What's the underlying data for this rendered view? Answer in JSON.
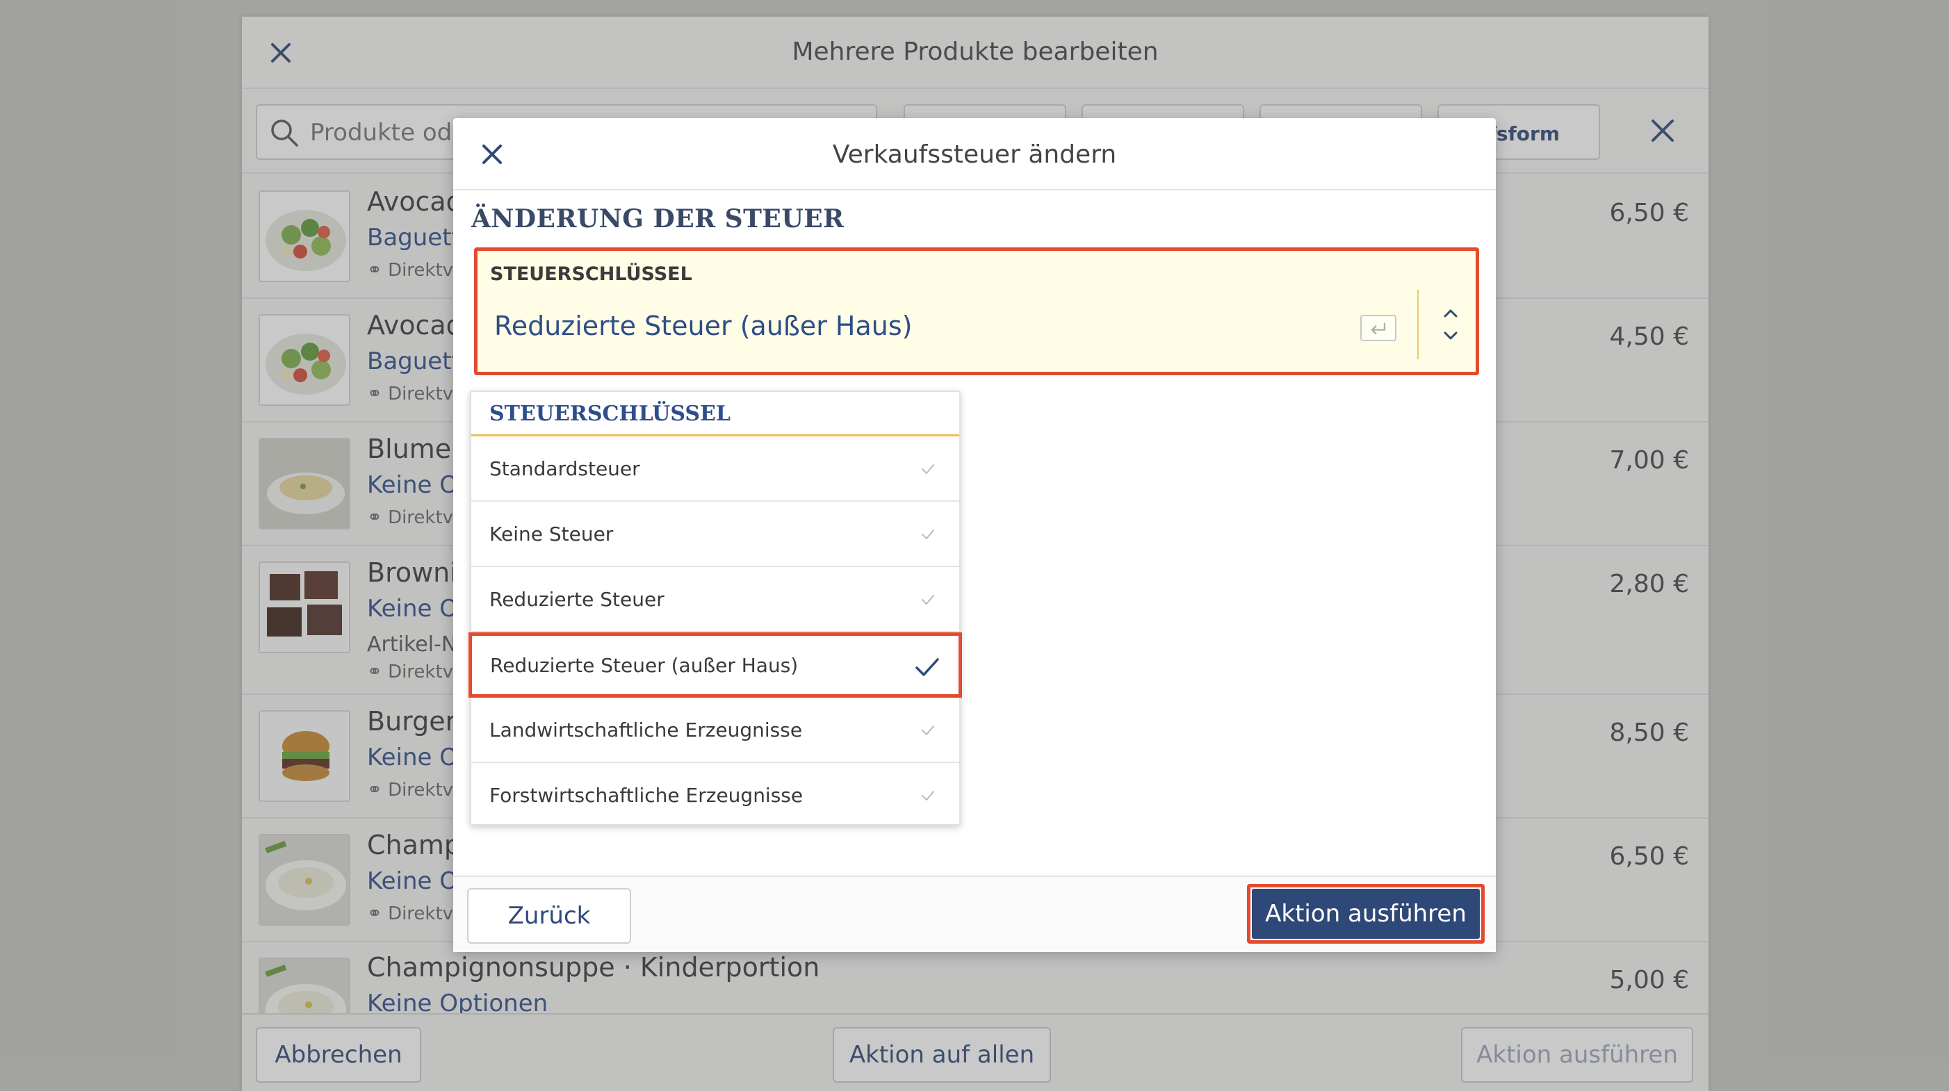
{
  "sheet": {
    "title": "Mehrere Produkte bearbeiten",
    "search_placeholder": "Produkte oder",
    "filter_visible_fragment": "ufsform",
    "products": [
      {
        "name": "Avocad",
        "sub": "Baguette",
        "meta": "Direktve",
        "extra": "",
        "price": "6,50 €"
      },
      {
        "name": "Avocad",
        "sub": "Baguette",
        "meta": "Direktve",
        "extra": "",
        "price": "4,50 €"
      },
      {
        "name": "Blumen",
        "sub": "Keine Op",
        "meta": "Direktve",
        "extra": "",
        "price": "7,00 €"
      },
      {
        "name": "Browni",
        "sub": "Keine Op",
        "meta": "Direktve",
        "extra": "Artikel-N",
        "price": "2,80 €"
      },
      {
        "name": "Burger",
        "sub": "Keine Op",
        "meta": "Direktve",
        "extra": "",
        "price": "8,50 €"
      },
      {
        "name": "Champi",
        "sub": "Keine Op",
        "meta": "Direktve",
        "extra": "",
        "price": "6,50 €"
      },
      {
        "name": "Champignonsuppe · Kinderportion",
        "sub": "Keine Optionen",
        "meta": "",
        "extra": "",
        "price": "5,00 €"
      }
    ],
    "footer": {
      "cancel": "Abbrechen",
      "action_all": "Aktion auf allen",
      "execute": "Aktion ausführen"
    }
  },
  "modal": {
    "title": "Verkaufssteuer ändern",
    "section_title": "ÄNDERUNG DER STEUER",
    "field_label": "STEUERSCHLÜSSEL",
    "field_value": "Reduzierte Steuer (außer Haus)",
    "dropdown_header": "STEUERSCHLÜSSEL",
    "options": [
      {
        "label": "Standardsteuer",
        "selected": false
      },
      {
        "label": "Keine Steuer",
        "selected": false
      },
      {
        "label": "Reduzierte Steuer",
        "selected": false
      },
      {
        "label": "Reduzierte Steuer (außer Haus)",
        "selected": true
      },
      {
        "label": "Landwirtschaftliche Erzeugnisse",
        "selected": false
      },
      {
        "label": "Forstwirtschaftliche Erzeugnisse",
        "selected": false
      }
    ],
    "back_button": "Zurück",
    "execute_button": "Aktion ausführen"
  },
  "colors": {
    "accent": "#2e4878",
    "highlight_border": "#e34a2e",
    "field_bg": "#fffde6"
  },
  "icons": {
    "close": "close-icon",
    "search": "search-icon",
    "enter": "enter-key-icon",
    "updown": "chevron-updown-icon",
    "check": "check-icon"
  }
}
